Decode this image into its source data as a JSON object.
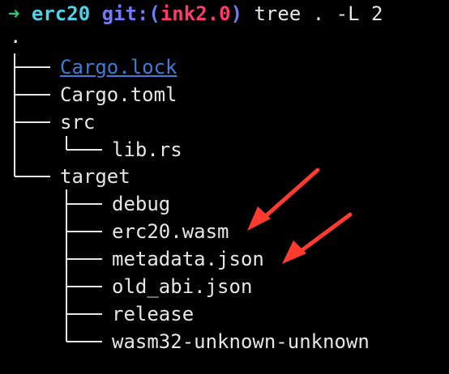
{
  "prompt": {
    "arrow": "➜",
    "directory": "erc20",
    "git_label": "git:(",
    "branch": "ink2.0",
    "git_close": ")",
    "command": "tree . -L 2"
  },
  "tree": {
    "root": ".",
    "items": [
      {
        "label": "Cargo.lock",
        "link": true
      },
      {
        "label": "Cargo.toml"
      },
      {
        "label": "src"
      },
      {
        "label": "lib.rs"
      },
      {
        "label": "target"
      },
      {
        "label": "debug"
      },
      {
        "label": "erc20.wasm"
      },
      {
        "label": "metadata.json"
      },
      {
        "label": "old_abi.json"
      },
      {
        "label": "release"
      },
      {
        "label": "wasm32-unknown-unknown"
      }
    ]
  },
  "colors": {
    "background": "#000000",
    "arrow_green": "#2ecc71",
    "directory_cyan": "#4fd1e6",
    "git_blue": "#6f7cf5",
    "branch_red": "#ff3b6b",
    "link_blue": "#3f7bd8",
    "annotation_arrow": "#ff3b30"
  },
  "annotations": [
    {
      "icon": "red-arrow-icon",
      "target": "erc20.wasm"
    },
    {
      "icon": "red-arrow-icon",
      "target": "metadata.json"
    }
  ]
}
